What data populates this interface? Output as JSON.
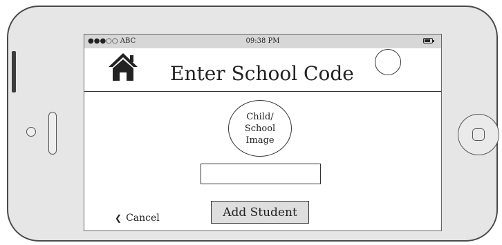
{
  "status_bar": {
    "carrier": "●●●○○ ABC",
    "time": "09:38 PM",
    "battery_icon": "battery-icon"
  },
  "header": {
    "home_icon": "house-icon",
    "title": "Enter School Code",
    "avatar_icon": "empty-circle"
  },
  "main": {
    "image_placeholder": "Child/\nSchool\nImage",
    "code_input": {
      "value": "",
      "placeholder": ""
    },
    "cancel_label": "Cancel",
    "add_student_label": "Add Student"
  },
  "colors": {
    "device_body": "#e6e6e6",
    "status_bar": "#d7d7d7",
    "button_fill": "#dedede",
    "ink": "#222222"
  }
}
